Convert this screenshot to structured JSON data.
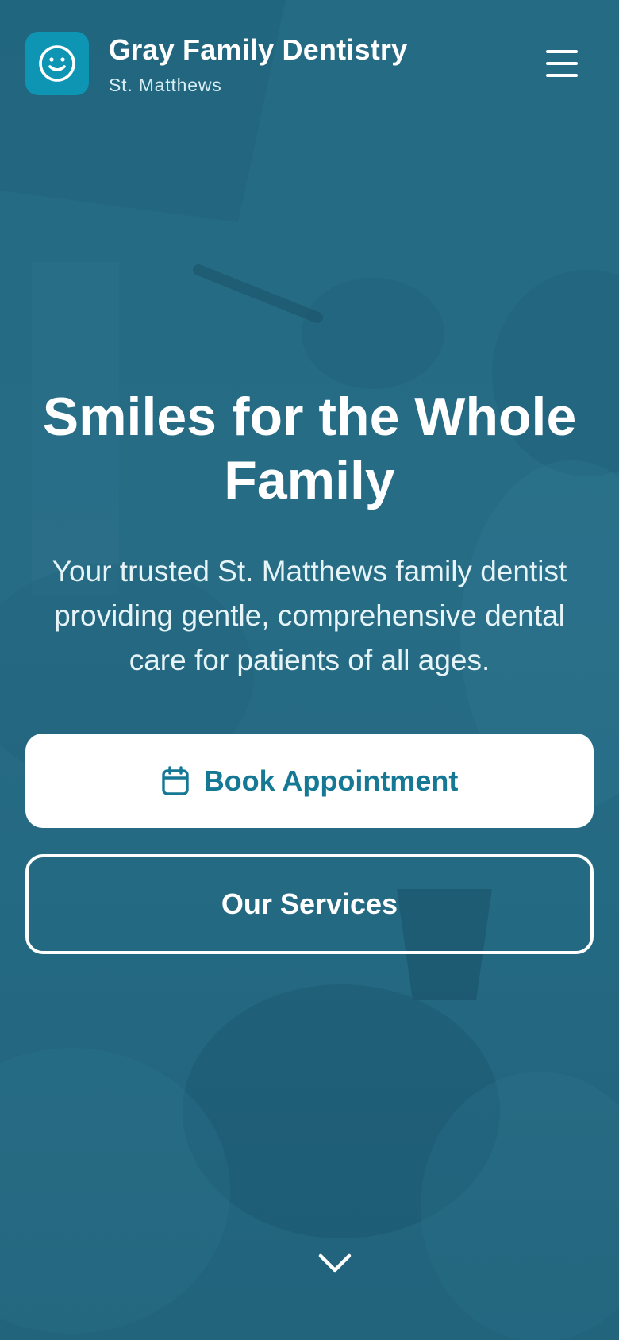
{
  "header": {
    "logo_icon": "smile-icon",
    "practice_name": "Gray Family Dentistry",
    "location": "St. Matthews",
    "menu_icon": "hamburger-menu-icon"
  },
  "hero": {
    "headline": "Smiles for the Whole Family",
    "description": "Your trusted St. Matthews family dentist providing gentle, comprehensive dental care for patients of all ages.",
    "primary_button": {
      "icon": "calendar-icon",
      "label": "Book Appointment"
    },
    "secondary_button": {
      "label": "Our Services"
    },
    "scroll_icon": "chevron-down-icon"
  },
  "colors": {
    "overlay": "#2a6f88",
    "logo_tile": "#0f95b4",
    "primary_button_text": "#157894",
    "text": "#ffffff"
  }
}
